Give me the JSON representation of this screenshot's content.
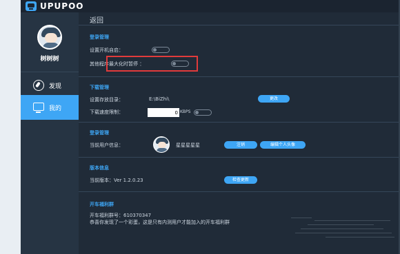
{
  "app": {
    "brand": "UPUPOO"
  },
  "sidebar": {
    "username": "树树树",
    "items": [
      {
        "label": "发现",
        "icon": "compass-icon"
      },
      {
        "label": "我的",
        "icon": "monitor-icon"
      }
    ]
  },
  "header": {
    "back_label": "返回"
  },
  "startup": {
    "title": "登录管理",
    "auto_start_label": "设置开机自启：",
    "pause_label": "其他程序最大化时暂停 ："
  },
  "download": {
    "title": "下载管理",
    "path_label": "设置存放目录：",
    "path_value": "E:\\BiZhi\\",
    "change_button": "更改",
    "speed_label": "下载速度限制：",
    "speed_value": "0",
    "speed_unit": "KBPS"
  },
  "account": {
    "title": "登录管理",
    "user_label": "当前用户信息：",
    "nickname": "星星星星星",
    "logout_button": "注销",
    "edit_avatar_button": "编辑个人头像"
  },
  "version": {
    "title": "版本信息",
    "current_label": "当前版本：Ver 1.2.0.23",
    "check_button": "检查更新"
  },
  "welfare": {
    "title": "开车福利群",
    "group_number": "开车福利群号：610370347",
    "message": "恭喜你发现了一个彩蛋，这是只有内测用户才能加入的开车福利群"
  },
  "colors": {
    "accent": "#3ea6f5",
    "background": "#202b38",
    "sidebar": "#263443",
    "highlight": "#e23b3b"
  }
}
